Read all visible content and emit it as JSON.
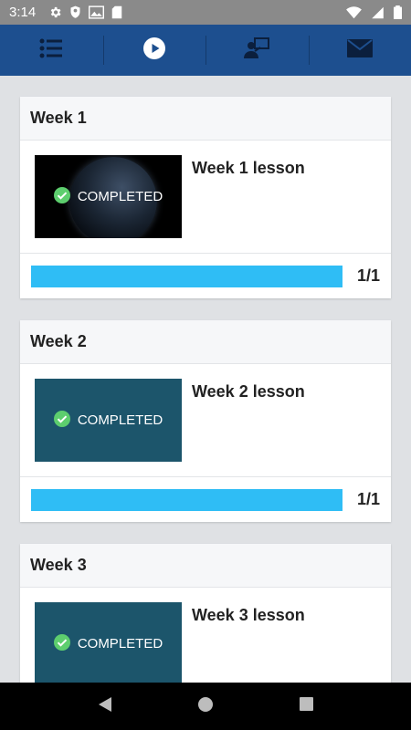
{
  "status_bar": {
    "time": "3:14"
  },
  "top_nav": {
    "tabs": [
      {
        "icon": "list-icon"
      },
      {
        "icon": "play-icon",
        "active": true
      },
      {
        "icon": "presenter-icon"
      },
      {
        "icon": "mail-icon"
      }
    ]
  },
  "weeks": [
    {
      "header": "Week 1",
      "lesson_title": "Week 1 lesson",
      "thumb_label": "COMPLETED",
      "thumb_style": "space",
      "progress": 1.0,
      "count": "1/1"
    },
    {
      "header": "Week 2",
      "lesson_title": "Week 2 lesson",
      "thumb_label": "COMPLETED",
      "thumb_style": "teal",
      "progress": 1.0,
      "count": "1/1"
    },
    {
      "header": "Week 3",
      "lesson_title": "Week 3 lesson",
      "thumb_label": "COMPLETED",
      "thumb_style": "teal"
    }
  ],
  "colors": {
    "top_nav": "#1d4f8f",
    "progress": "#2fbdf5",
    "check": "#5dce6e",
    "thumb_teal": "#1c556b"
  }
}
